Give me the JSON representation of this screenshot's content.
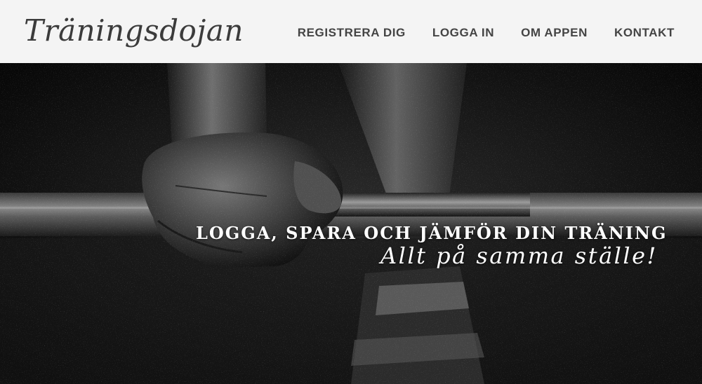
{
  "header": {
    "logo": "Träningsdojan",
    "nav": [
      {
        "label": "REGISTRERA DIG"
      },
      {
        "label": "LOGGA IN"
      },
      {
        "label": "OM APPEN"
      },
      {
        "label": "KONTAKT"
      }
    ]
  },
  "hero": {
    "tagline": "LOGGA, SPARA OCH JÄMFÖR DIN TRÄNING",
    "subline": "Allt på samma ställe!"
  },
  "colors": {
    "header_bg": "#f4f4f4",
    "nav_text": "#444444",
    "logo_text": "#3b3b3b",
    "hero_text": "#ffffff"
  }
}
